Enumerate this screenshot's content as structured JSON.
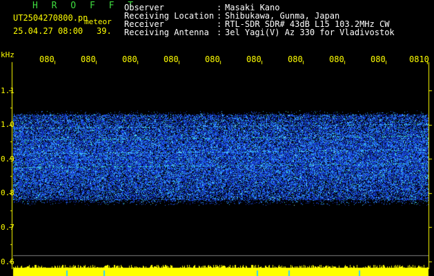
{
  "header": {
    "station": "H R O F F T",
    "file_name": "UT2504270800.pn",
    "overlay_word": "meteor",
    "date_time": "25.04.27 08:00",
    "count": "39."
  },
  "info": {
    "rows": [
      {
        "label": "Observer",
        "value": "Masaki Kano"
      },
      {
        "label": "Receiving Location",
        "value": "Shibukawa, Gunma, Japan"
      },
      {
        "label": "Receiver",
        "value": "RTL-SDR SDR# 43dB L15 103.2MHz CW"
      },
      {
        "label": "Receiving Antenna",
        "value": "3el Yagi(V) Az 330 for Vladivostok"
      }
    ]
  },
  "chart_data": {
    "type": "heatmap",
    "ylabel": "kHz",
    "y_ticks": [
      "1.1",
      "1.0",
      "0.9",
      "0.8",
      "0.7",
      "0.6"
    ],
    "y_range": [
      0.6,
      1.1
    ],
    "x_ticks": [
      "080",
      "080",
      "080",
      "080",
      "080",
      "080",
      "080",
      "080",
      "080",
      "0810"
    ],
    "signal_band_khz": [
      0.78,
      1.03
    ],
    "colors": {
      "background": "#000000",
      "signal": "#2a6bff",
      "text": "#ffff00",
      "bottom_bar": "#ffff00",
      "guide_line": "#808080"
    }
  }
}
